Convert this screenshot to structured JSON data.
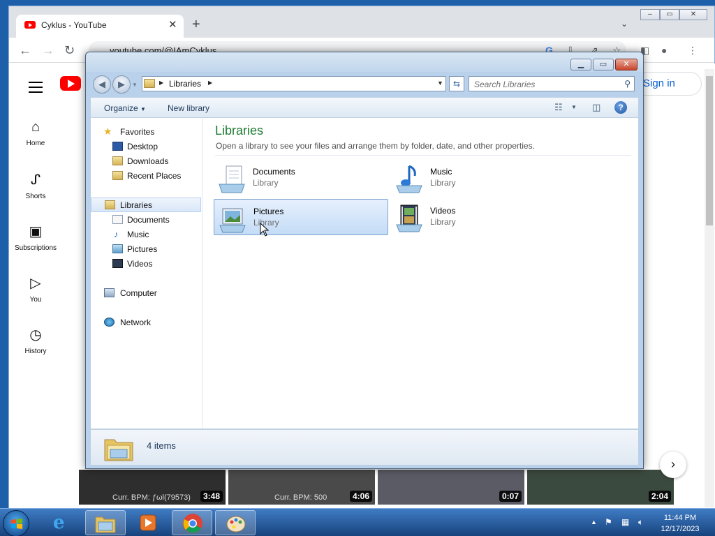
{
  "browser": {
    "tab_title": "Cyklus - YouTube",
    "url": "youtube.com/@IAmCyklus",
    "sign_in_label": "Sign in",
    "sidebar": [
      {
        "label": "Home",
        "icon": "home-icon"
      },
      {
        "label": "Shorts",
        "icon": "shorts-icon"
      },
      {
        "label": "Subscriptions",
        "icon": "subscriptions-icon"
      },
      {
        "label": "You",
        "icon": "you-icon"
      },
      {
        "label": "History",
        "icon": "history-icon"
      }
    ],
    "videos": [
      {
        "bpm": "Curr. BPM: ƒωl(79573)",
        "duration": "3:48"
      },
      {
        "bpm": "Curr. BPM: 500",
        "duration": "4:06"
      },
      {
        "bpm": "",
        "duration": "0:07"
      },
      {
        "bpm": "",
        "duration": "2:04"
      }
    ]
  },
  "explorer": {
    "address_crumb": "Libraries",
    "search_placeholder": "Search Libraries",
    "commands": {
      "organize": "Organize",
      "new_library": "New library"
    },
    "nav": {
      "favorites": "Favorites",
      "favorites_items": [
        "Desktop",
        "Downloads",
        "Recent Places"
      ],
      "libraries": "Libraries",
      "libraries_items": [
        "Documents",
        "Music",
        "Pictures",
        "Videos"
      ],
      "computer": "Computer",
      "network": "Network"
    },
    "content": {
      "title": "Libraries",
      "subtitle": "Open a library to see your files and arrange them by folder, date, and other properties.",
      "libraries": [
        {
          "name": "Documents",
          "kind": "Library",
          "icon": "documents-library-icon"
        },
        {
          "name": "Music",
          "kind": "Library",
          "icon": "music-library-icon"
        },
        {
          "name": "Pictures",
          "kind": "Library",
          "icon": "pictures-library-icon",
          "selected": true
        },
        {
          "name": "Videos",
          "kind": "Library",
          "icon": "videos-library-icon"
        }
      ]
    },
    "status": "4 items"
  },
  "taskbar": {
    "time": "11:44 PM",
    "date": "12/17/2023",
    "pinned": [
      "internet-explorer-icon",
      "windows-explorer-icon",
      "media-player-icon",
      "chrome-icon",
      "paint-icon"
    ]
  }
}
